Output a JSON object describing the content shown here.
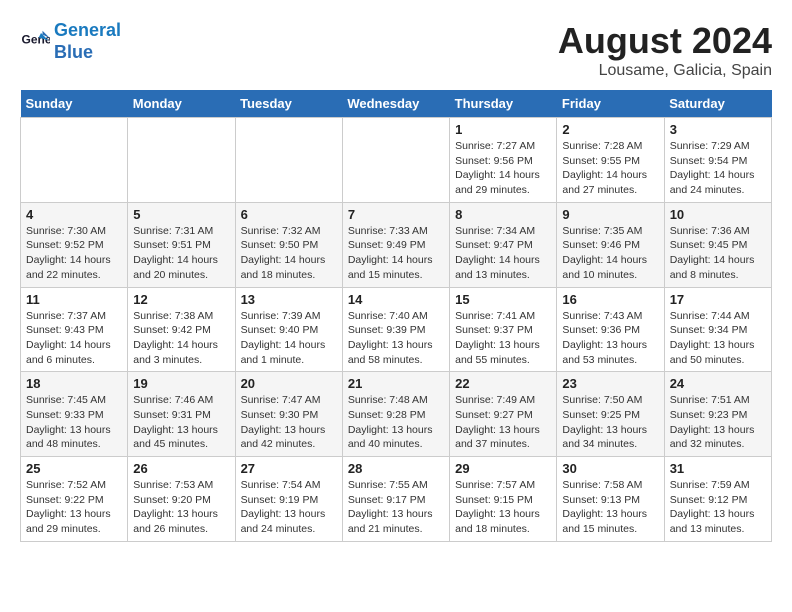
{
  "header": {
    "logo_line1": "General",
    "logo_line2": "Blue",
    "month": "August 2024",
    "location": "Lousame, Galicia, Spain"
  },
  "weekdays": [
    "Sunday",
    "Monday",
    "Tuesday",
    "Wednesday",
    "Thursday",
    "Friday",
    "Saturday"
  ],
  "weeks": [
    [
      {
        "day": "",
        "info": ""
      },
      {
        "day": "",
        "info": ""
      },
      {
        "day": "",
        "info": ""
      },
      {
        "day": "",
        "info": ""
      },
      {
        "day": "1",
        "info": "Sunrise: 7:27 AM\nSunset: 9:56 PM\nDaylight: 14 hours\nand 29 minutes."
      },
      {
        "day": "2",
        "info": "Sunrise: 7:28 AM\nSunset: 9:55 PM\nDaylight: 14 hours\nand 27 minutes."
      },
      {
        "day": "3",
        "info": "Sunrise: 7:29 AM\nSunset: 9:54 PM\nDaylight: 14 hours\nand 24 minutes."
      }
    ],
    [
      {
        "day": "4",
        "info": "Sunrise: 7:30 AM\nSunset: 9:52 PM\nDaylight: 14 hours\nand 22 minutes."
      },
      {
        "day": "5",
        "info": "Sunrise: 7:31 AM\nSunset: 9:51 PM\nDaylight: 14 hours\nand 20 minutes."
      },
      {
        "day": "6",
        "info": "Sunrise: 7:32 AM\nSunset: 9:50 PM\nDaylight: 14 hours\nand 18 minutes."
      },
      {
        "day": "7",
        "info": "Sunrise: 7:33 AM\nSunset: 9:49 PM\nDaylight: 14 hours\nand 15 minutes."
      },
      {
        "day": "8",
        "info": "Sunrise: 7:34 AM\nSunset: 9:47 PM\nDaylight: 14 hours\nand 13 minutes."
      },
      {
        "day": "9",
        "info": "Sunrise: 7:35 AM\nSunset: 9:46 PM\nDaylight: 14 hours\nand 10 minutes."
      },
      {
        "day": "10",
        "info": "Sunrise: 7:36 AM\nSunset: 9:45 PM\nDaylight: 14 hours\nand 8 minutes."
      }
    ],
    [
      {
        "day": "11",
        "info": "Sunrise: 7:37 AM\nSunset: 9:43 PM\nDaylight: 14 hours\nand 6 minutes."
      },
      {
        "day": "12",
        "info": "Sunrise: 7:38 AM\nSunset: 9:42 PM\nDaylight: 14 hours\nand 3 minutes."
      },
      {
        "day": "13",
        "info": "Sunrise: 7:39 AM\nSunset: 9:40 PM\nDaylight: 14 hours\nand 1 minute."
      },
      {
        "day": "14",
        "info": "Sunrise: 7:40 AM\nSunset: 9:39 PM\nDaylight: 13 hours\nand 58 minutes."
      },
      {
        "day": "15",
        "info": "Sunrise: 7:41 AM\nSunset: 9:37 PM\nDaylight: 13 hours\nand 55 minutes."
      },
      {
        "day": "16",
        "info": "Sunrise: 7:43 AM\nSunset: 9:36 PM\nDaylight: 13 hours\nand 53 minutes."
      },
      {
        "day": "17",
        "info": "Sunrise: 7:44 AM\nSunset: 9:34 PM\nDaylight: 13 hours\nand 50 minutes."
      }
    ],
    [
      {
        "day": "18",
        "info": "Sunrise: 7:45 AM\nSunset: 9:33 PM\nDaylight: 13 hours\nand 48 minutes."
      },
      {
        "day": "19",
        "info": "Sunrise: 7:46 AM\nSunset: 9:31 PM\nDaylight: 13 hours\nand 45 minutes."
      },
      {
        "day": "20",
        "info": "Sunrise: 7:47 AM\nSunset: 9:30 PM\nDaylight: 13 hours\nand 42 minutes."
      },
      {
        "day": "21",
        "info": "Sunrise: 7:48 AM\nSunset: 9:28 PM\nDaylight: 13 hours\nand 40 minutes."
      },
      {
        "day": "22",
        "info": "Sunrise: 7:49 AM\nSunset: 9:27 PM\nDaylight: 13 hours\nand 37 minutes."
      },
      {
        "day": "23",
        "info": "Sunrise: 7:50 AM\nSunset: 9:25 PM\nDaylight: 13 hours\nand 34 minutes."
      },
      {
        "day": "24",
        "info": "Sunrise: 7:51 AM\nSunset: 9:23 PM\nDaylight: 13 hours\nand 32 minutes."
      }
    ],
    [
      {
        "day": "25",
        "info": "Sunrise: 7:52 AM\nSunset: 9:22 PM\nDaylight: 13 hours\nand 29 minutes."
      },
      {
        "day": "26",
        "info": "Sunrise: 7:53 AM\nSunset: 9:20 PM\nDaylight: 13 hours\nand 26 minutes."
      },
      {
        "day": "27",
        "info": "Sunrise: 7:54 AM\nSunset: 9:19 PM\nDaylight: 13 hours\nand 24 minutes."
      },
      {
        "day": "28",
        "info": "Sunrise: 7:55 AM\nSunset: 9:17 PM\nDaylight: 13 hours\nand 21 minutes."
      },
      {
        "day": "29",
        "info": "Sunrise: 7:57 AM\nSunset: 9:15 PM\nDaylight: 13 hours\nand 18 minutes."
      },
      {
        "day": "30",
        "info": "Sunrise: 7:58 AM\nSunset: 9:13 PM\nDaylight: 13 hours\nand 15 minutes."
      },
      {
        "day": "31",
        "info": "Sunrise: 7:59 AM\nSunset: 9:12 PM\nDaylight: 13 hours\nand 13 minutes."
      }
    ]
  ]
}
